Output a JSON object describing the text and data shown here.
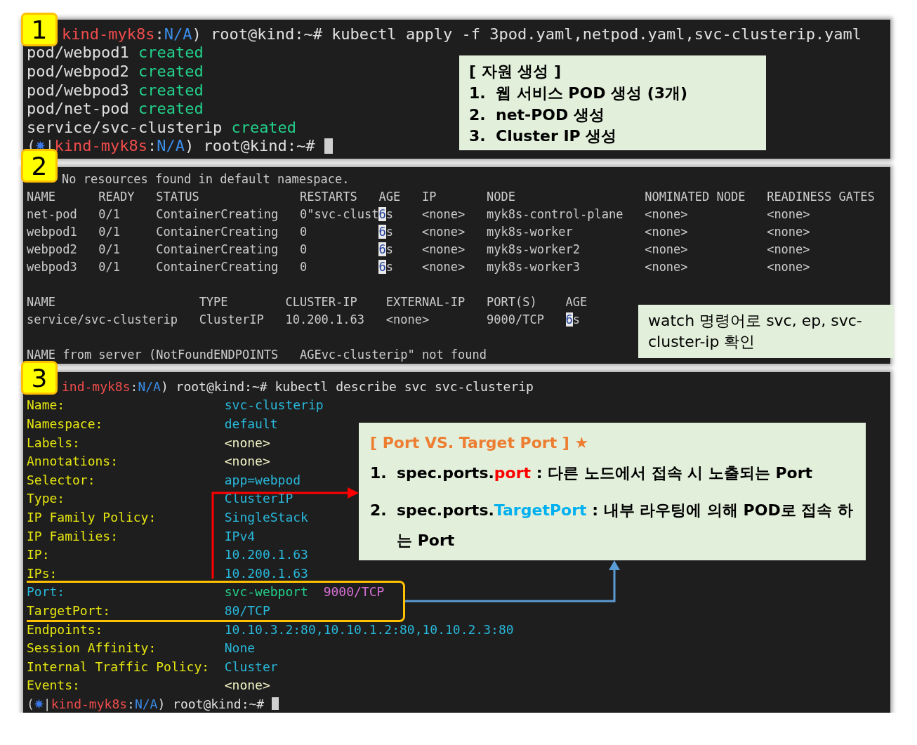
{
  "panels": [
    {
      "badge": "1",
      "lines": [
        {
          "kind": "prompt",
          "context": "kind-myk8s",
          "colon": ":",
          "namespace": "N/A",
          "user": ") root@kind:~#",
          "command": "kubectl apply -f 3pod.yaml,netpod.yaml,svc-clusterip.yaml"
        },
        {
          "kind": "output",
          "text": "pod/webpod1",
          "status": "created"
        },
        {
          "kind": "output",
          "text": "pod/webpod2",
          "status": "created"
        },
        {
          "kind": "output",
          "text": "pod/webpod3",
          "status": "created"
        },
        {
          "kind": "output",
          "text": "pod/net-pod",
          "status": "created"
        },
        {
          "kind": "output",
          "text": "service/svc-clusterip",
          "status": "created"
        },
        {
          "kind": "prompt",
          "open": "(",
          "separator": "|",
          "context": "kind-myk8s",
          "colon": ":",
          "namespace": "N/A",
          "user": ") root@kind:~#",
          "cursor": true
        }
      ],
      "note": {
        "kind": "list",
        "title": "[ 자원 생성 ]",
        "items": [
          {
            "number": "1.",
            "text": "웹 서비스 POD 생성 (3개)"
          },
          {
            "number": "2.",
            "text": "net-POD 생성"
          },
          {
            "number": "3.",
            "text": "Cluster IP 생성"
          }
        ]
      }
    },
    {
      "badge": "2",
      "lines": [
        {
          "kind": "text",
          "text": "No resources found in default namespace."
        },
        {
          "kind": "table",
          "columns": [
            "NAME",
            "READY",
            "STATUS",
            "RESTARTS",
            "AGE",
            "IP",
            "NODE",
            "NOMINATED NODE",
            "READINESS GATES"
          ],
          "rows": [
            [
              "net-pod",
              "0/1",
              "ContainerCreating",
              "0\"svc-clust",
              {
                "cursor": "6",
                "text": "s"
              },
              "<none>",
              "myk8s-control-plane",
              "<none>",
              "<none>"
            ],
            [
              "webpod1",
              "0/1",
              "ContainerCreating",
              "0",
              {
                "cursor": "6",
                "text": "s"
              },
              "<none>",
              "myk8s-worker",
              "<none>",
              "<none>"
            ],
            [
              "webpod2",
              "0/1",
              "ContainerCreating",
              "0",
              {
                "cursor": "6",
                "text": "s"
              },
              "<none>",
              "myk8s-worker2",
              "<none>",
              "<none>"
            ],
            [
              "webpod3",
              "0/1",
              "ContainerCreating",
              "0",
              {
                "cursor": "6",
                "text": "s"
              },
              "<none>",
              "myk8s-worker3",
              "<none>",
              "<none>"
            ]
          ]
        },
        {
          "kind": "table",
          "columns": [
            "NAME",
            "TYPE",
            "CLUSTER-IP",
            "EXTERNAL-IP",
            "PORT(S)",
            "AGE"
          ],
          "rows": [
            [
              "service/svc-clusterip",
              "ClusterIP",
              "10.200.1.63",
              "<none>",
              "9000/TCP",
              {
                "cursor": "6",
                "text": "s"
              }
            ]
          ]
        },
        {
          "kind": "text",
          "text": "NAME from server (NotFoundENDPOINTS   AGEvc-clusterip\" not found"
        }
      ],
      "note": {
        "kind": "plain",
        "text": "watch 명령어로 svc, ep, svc-cluster-ip 확인"
      }
    },
    {
      "badge": "3",
      "lines": [
        {
          "kind": "prompt",
          "context": "ind-myk8s",
          "colon": ":",
          "namespace": "N/A",
          "user": ") root@kind:~#",
          "command": "kubectl describe svc svc-clusterip"
        },
        {
          "kind": "fields",
          "items": [
            {
              "key": "Name:",
              "color": "#e5e510",
              "values": [
                {
                  "text": "svc-clusterip",
                  "color": "#29b8db"
                }
              ]
            },
            {
              "key": "Namespace:",
              "color": "#e5e510",
              "values": [
                {
                  "text": "default",
                  "color": "#29b8db"
                }
              ]
            },
            {
              "key": "Labels:",
              "color": "#e5e510",
              "values": [
                {
                  "text": "<none>",
                  "color": "#f5f5c8"
                }
              ]
            },
            {
              "key": "Annotations:",
              "color": "#e5e510",
              "values": [
                {
                  "text": "<none>",
                  "color": "#f5f5c8"
                }
              ]
            },
            {
              "key": "Selector:",
              "color": "#e5e510",
              "values": [
                {
                  "text": "app=webpod",
                  "color": "#29b8db"
                }
              ]
            },
            {
              "key": "Type:",
              "color": "#e5e510",
              "values": [
                {
                  "text": "ClusterIP",
                  "color": "#29b8db"
                }
              ]
            },
            {
              "key": "IP Family Policy:",
              "color": "#e5e510",
              "values": [
                {
                  "text": "SingleStack",
                  "color": "#29b8db"
                }
              ]
            },
            {
              "key": "IP Families:",
              "color": "#e5e510",
              "values": [
                {
                  "text": "IPv4",
                  "color": "#29b8db"
                }
              ]
            },
            {
              "key": "IP:",
              "color": "#e5e510",
              "values": [
                {
                  "text": "10.200.1.63",
                  "color": "#29b8db"
                }
              ]
            },
            {
              "key": "IPs:",
              "color": "#e5e510",
              "values": [
                {
                  "text": "10.200.1.63",
                  "color": "#29b8db"
                }
              ]
            }
          ]
        },
        {
          "kind": "fields",
          "framed": true,
          "items": [
            {
              "key": "Port:",
              "color": "#29b8db",
              "values": [
                {
                  "text": "svc-webport",
                  "color": "#23d18b"
                },
                {
                  "text": "9000/TCP",
                  "color": "#d670d6"
                }
              ]
            },
            {
              "key": "TargetPort:",
              "color": "#e5e510",
              "values": [
                {
                  "text": "80/TCP",
                  "color": "#29b8db"
                }
              ]
            }
          ]
        },
        {
          "kind": "fields",
          "items": [
            {
              "key": "Endpoints:",
              "color": "#e5e510",
              "values": [
                {
                  "text": "10.10.3.2:80,10.10.1.2:80,10.10.2.3:80",
                  "color": "#29b8db"
                }
              ]
            },
            {
              "key": "Session Affinity:",
              "color": "#e5e510",
              "values": [
                {
                  "text": "None",
                  "color": "#29b8db"
                }
              ]
            },
            {
              "key": "Internal Traffic Policy:",
              "color": "#e5e510",
              "values": [
                {
                  "text": "Cluster",
                  "color": "#29b8db"
                }
              ]
            },
            {
              "key": "Events:",
              "color": "#e5e510",
              "values": [
                {
                  "text": "<none>",
                  "color": "#f5f5c8"
                }
              ]
            }
          ]
        },
        {
          "kind": "prompt",
          "open": "(",
          "separator": "|",
          "context": "kind-myk8s",
          "colon": ":",
          "namespace": "N/A",
          "user": ") root@kind:~#",
          "cursor": true
        }
      ],
      "note": {
        "kind": "terms",
        "title": "[ Port VS. Target Port ] ★",
        "items": [
          {
            "number": "1.",
            "prefix": "spec.ports.",
            "term": "port",
            "color": "#ff0000",
            "rest": " : 다른 노드에서 접속 시 노출되는 Port"
          },
          {
            "number": "2.",
            "prefix": "spec.ports.",
            "term": "TargetPort",
            "color": "#00b0f0",
            "rest": " : 내부 라우팅에 의해 POD로 접속 하는 Port"
          }
        ]
      }
    }
  ]
}
